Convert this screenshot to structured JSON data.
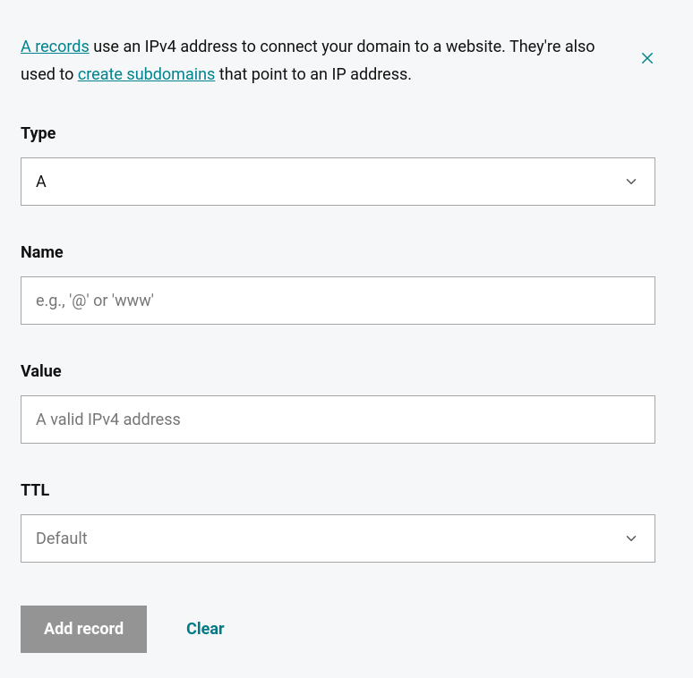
{
  "info": {
    "link1": "A records",
    "text1": " use an IPv4 address to connect your domain to a website. They're also used to ",
    "link2": "create subdomains",
    "text2": " that point to an IP address."
  },
  "fields": {
    "type": {
      "label": "Type",
      "value": "A"
    },
    "name": {
      "label": "Name",
      "placeholder": "e.g., '@' or 'www'"
    },
    "value": {
      "label": "Value",
      "placeholder": "A valid IPv4 address"
    },
    "ttl": {
      "label": "TTL",
      "value": "Default"
    }
  },
  "actions": {
    "add": "Add record",
    "clear": "Clear"
  }
}
